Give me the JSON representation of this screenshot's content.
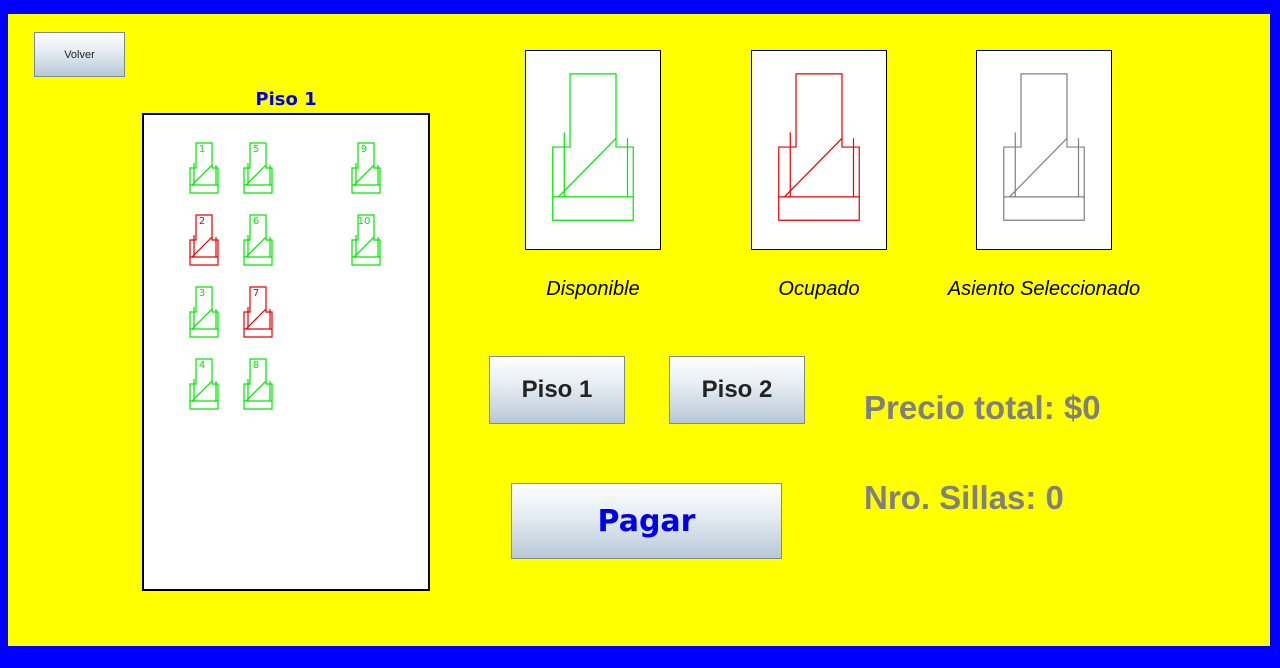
{
  "back_label": "Volver",
  "floor_title": "Piso 1",
  "colors": {
    "available": "#00e600",
    "occupied": "#e60000",
    "selected": "#808080",
    "background": "#ffff00",
    "border": "#0000ff"
  },
  "seats": [
    {
      "number": "1",
      "status": "available"
    },
    {
      "number": "2",
      "status": "occupied"
    },
    {
      "number": "3",
      "status": "available"
    },
    {
      "number": "4",
      "status": "available"
    },
    {
      "number": "5",
      "status": "available"
    },
    {
      "number": "6",
      "status": "available"
    },
    {
      "number": "7",
      "status": "occupied"
    },
    {
      "number": "8",
      "status": "available"
    },
    {
      "number": "9",
      "status": "available"
    },
    {
      "number": "10",
      "status": "available"
    }
  ],
  "legend": {
    "available": "Disponible",
    "occupied": "Ocupado",
    "selected": "Asiento Seleccionado"
  },
  "buttons": {
    "floor1": "Piso 1",
    "floor2": "Piso 2",
    "pay": "Pagar"
  },
  "total_price": "Precio total: $0",
  "seat_count": "Nro. Sillas: 0"
}
